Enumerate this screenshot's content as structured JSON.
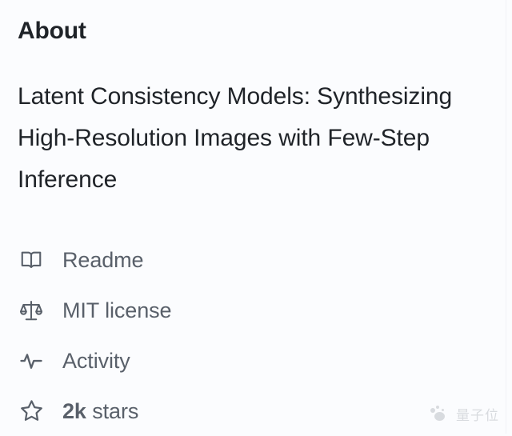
{
  "panel": {
    "heading": "About",
    "description": "Latent Consistency Models: Synthesizing High-Resolution Images with Few-Step Inference"
  },
  "meta": {
    "items": [
      {
        "icon": "book-icon",
        "label": "Readme"
      },
      {
        "icon": "scale-icon",
        "label": "MIT license"
      },
      {
        "icon": "pulse-icon",
        "label": "Activity"
      },
      {
        "icon": "star-icon",
        "count": "2k",
        "label": "stars"
      }
    ]
  },
  "watermark": {
    "text": "量子位"
  },
  "colors": {
    "background": "#fbfcfe",
    "heading_text": "#1f2328",
    "body_text": "#1f2328",
    "muted_text": "#59606a",
    "border": "#f0f2f6",
    "watermark": "#8b9099"
  }
}
